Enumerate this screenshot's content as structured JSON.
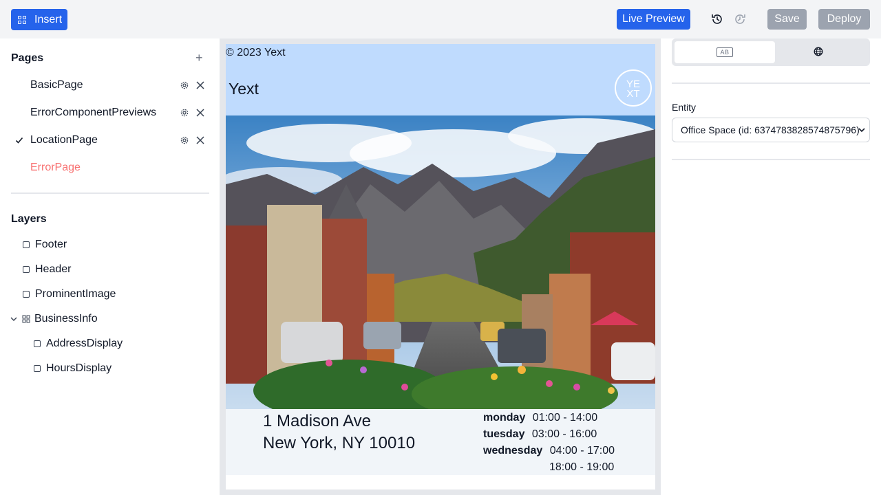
{
  "toolbar": {
    "insert_label": "Insert",
    "live_preview_label": "Live Preview",
    "save_label": "Save",
    "deploy_label": "Deploy"
  },
  "pages": {
    "title": "Pages",
    "items": [
      {
        "label": "BasicPage",
        "selected": false
      },
      {
        "label": "ErrorComponentPreviews",
        "selected": false
      },
      {
        "label": "LocationPage",
        "selected": true
      },
      {
        "label": "ErrorPage",
        "selected": false,
        "error": true
      }
    ]
  },
  "layers": {
    "title": "Layers",
    "items": [
      {
        "label": "Footer",
        "level": 0
      },
      {
        "label": "Header",
        "level": 0
      },
      {
        "label": "ProminentImage",
        "level": 0
      },
      {
        "label": "BusinessInfo",
        "level": 0,
        "expanded": true
      },
      {
        "label": "AddressDisplay",
        "level": 1
      },
      {
        "label": "HoursDisplay",
        "level": 1
      }
    ]
  },
  "preview": {
    "footer_text": "© 2023 Yext",
    "header_brand": "Yext",
    "logo_text": [
      "YE",
      "XT"
    ],
    "address": {
      "line1": "1 Madison Ave",
      "line2": "New York, NY 10010"
    },
    "hours": [
      {
        "day": "monday",
        "times": [
          "01:00 - 14:00"
        ]
      },
      {
        "day": "tuesday",
        "times": [
          "03:00 - 16:00"
        ]
      },
      {
        "day": "wednesday",
        "times": [
          "04:00 - 17:00",
          "18:00 - 19:00"
        ]
      }
    ]
  },
  "properties": {
    "tab_ab_label": "AB",
    "entity_label": "Entity",
    "entity_value": "Office Space (id: 6374783828574875796)"
  },
  "colors": {
    "primary": "#2563eb",
    "disabled": "#9ca3af",
    "preview_header_bg": "#bfdbfe",
    "error_text": "#f87171"
  }
}
